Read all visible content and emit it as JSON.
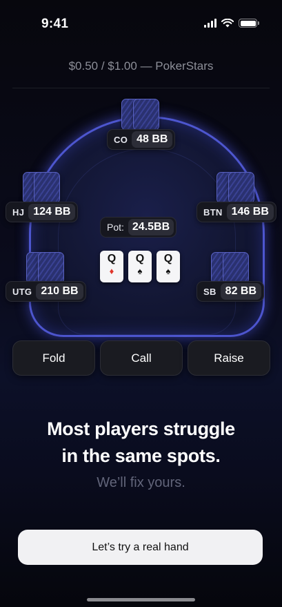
{
  "status_bar": {
    "time": "9:41"
  },
  "header": {
    "title": "$0.50 / $1.00 — PokerStars"
  },
  "table": {
    "seats": {
      "co": {
        "position": "CO",
        "stack": "48 BB"
      },
      "hj": {
        "position": "HJ",
        "stack": "124 BB"
      },
      "btn": {
        "position": "BTN",
        "stack": "146 BB"
      },
      "utg": {
        "position": "UTG",
        "stack": "210 BB"
      },
      "sb": {
        "position": "SB",
        "stack": "82 BB"
      }
    },
    "pot": {
      "label": "Pot:",
      "value": "24.5BB"
    },
    "board": [
      {
        "rank": "Q",
        "suit": "♦",
        "suit_color": "#e0352b"
      },
      {
        "rank": "Q",
        "suit": "♠",
        "suit_color": "#111111"
      },
      {
        "rank": "Q",
        "suit": "♠",
        "suit_color": "#111111"
      }
    ]
  },
  "actions": {
    "fold": "Fold",
    "call": "Call",
    "raise": "Raise"
  },
  "headline": {
    "line1": "Most players struggle",
    "line2": "in the same spots."
  },
  "subheadline": "We’ll fix yours.",
  "cta_label": "Let’s try a real hand",
  "colors": {
    "accent": "#5962c2",
    "background": "#07070d",
    "cta_bg": "#f1f1f3"
  }
}
